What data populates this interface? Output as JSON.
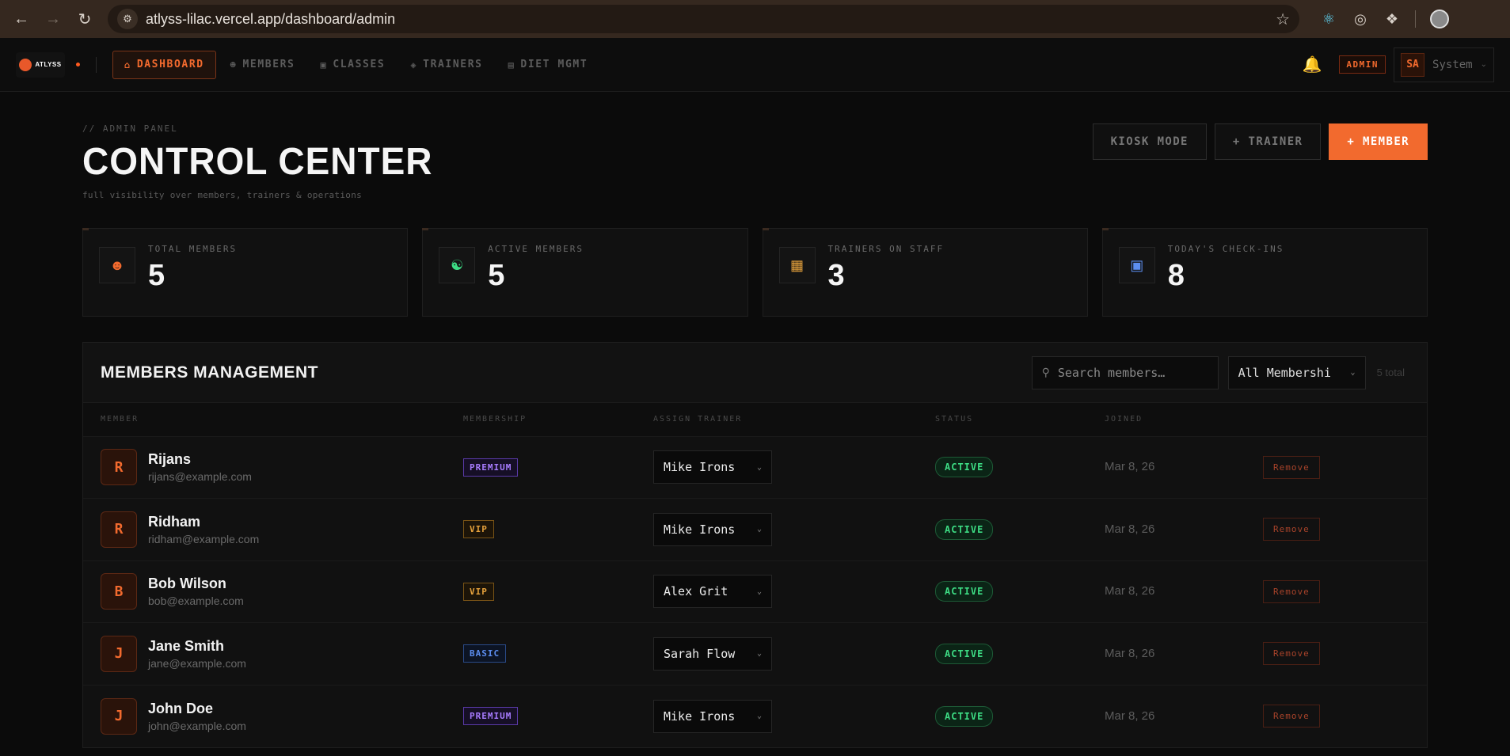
{
  "browser": {
    "url": "atlyss-lilac.vercel.app/dashboard/admin"
  },
  "app": {
    "logo_text": "ATLYSS",
    "nav": [
      {
        "label": "DASHBOARD",
        "icon": "home-icon",
        "active": true
      },
      {
        "label": "MEMBERS",
        "icon": "users-icon",
        "active": false
      },
      {
        "label": "CLASSES",
        "icon": "calendar-icon",
        "active": false
      },
      {
        "label": "TRAINERS",
        "icon": "dumbbell-icon",
        "active": false
      },
      {
        "label": "DIET MGMT",
        "icon": "clipboard-icon",
        "active": false
      }
    ],
    "role_badge": "ADMIN",
    "user": {
      "initials": "SA",
      "name": "System"
    }
  },
  "header": {
    "kicker": "// ADMIN PANEL",
    "title": "CONTROL CENTER",
    "subtitle": "full visibility over members, trainers & operations",
    "actions": {
      "kiosk": "KIOSK MODE",
      "trainer": "+ TRAINER",
      "member": "+ MEMBER"
    }
  },
  "stats": [
    {
      "label": "TOTAL MEMBERS",
      "value": "5",
      "icon": "users-icon",
      "color": "#f26a2e"
    },
    {
      "label": "ACTIVE MEMBERS",
      "value": "5",
      "icon": "group-icon",
      "color": "#3ddc84"
    },
    {
      "label": "TRAINERS ON STAFF",
      "value": "3",
      "icon": "building-icon",
      "color": "#e6a23c"
    },
    {
      "label": "TODAY'S CHECK-INS",
      "value": "8",
      "icon": "calendar-icon",
      "color": "#5c8ef0"
    }
  ],
  "members_panel": {
    "title": "MEMBERS MANAGEMENT",
    "search_placeholder": "Search members…",
    "filter_value": "All Membershi",
    "total_text": "5 total",
    "columns": [
      "MEMBER",
      "MEMBERSHIP",
      "ASSIGN TRAINER",
      "STATUS",
      "JOINED",
      ""
    ],
    "remove_label": "Remove",
    "rows": [
      {
        "initial": "R",
        "name": "Rijans",
        "email": "rijans@example.com",
        "tier": "PREMIUM",
        "trainer": "Mike Irons",
        "status": "ACTIVE",
        "joined": "Mar 8, 26"
      },
      {
        "initial": "R",
        "name": "Ridham",
        "email": "ridham@example.com",
        "tier": "VIP",
        "trainer": "Mike Irons",
        "status": "ACTIVE",
        "joined": "Mar 8, 26"
      },
      {
        "initial": "B",
        "name": "Bob Wilson",
        "email": "bob@example.com",
        "tier": "VIP",
        "trainer": "Alex Grit",
        "status": "ACTIVE",
        "joined": "Mar 8, 26"
      },
      {
        "initial": "J",
        "name": "Jane Smith",
        "email": "jane@example.com",
        "tier": "BASIC",
        "trainer": "Sarah Flow",
        "status": "ACTIVE",
        "joined": "Mar 8, 26"
      },
      {
        "initial": "J",
        "name": "John Doe",
        "email": "john@example.com",
        "tier": "PREMIUM",
        "trainer": "Mike Irons",
        "status": "ACTIVE",
        "joined": "Mar 8, 26"
      }
    ]
  }
}
